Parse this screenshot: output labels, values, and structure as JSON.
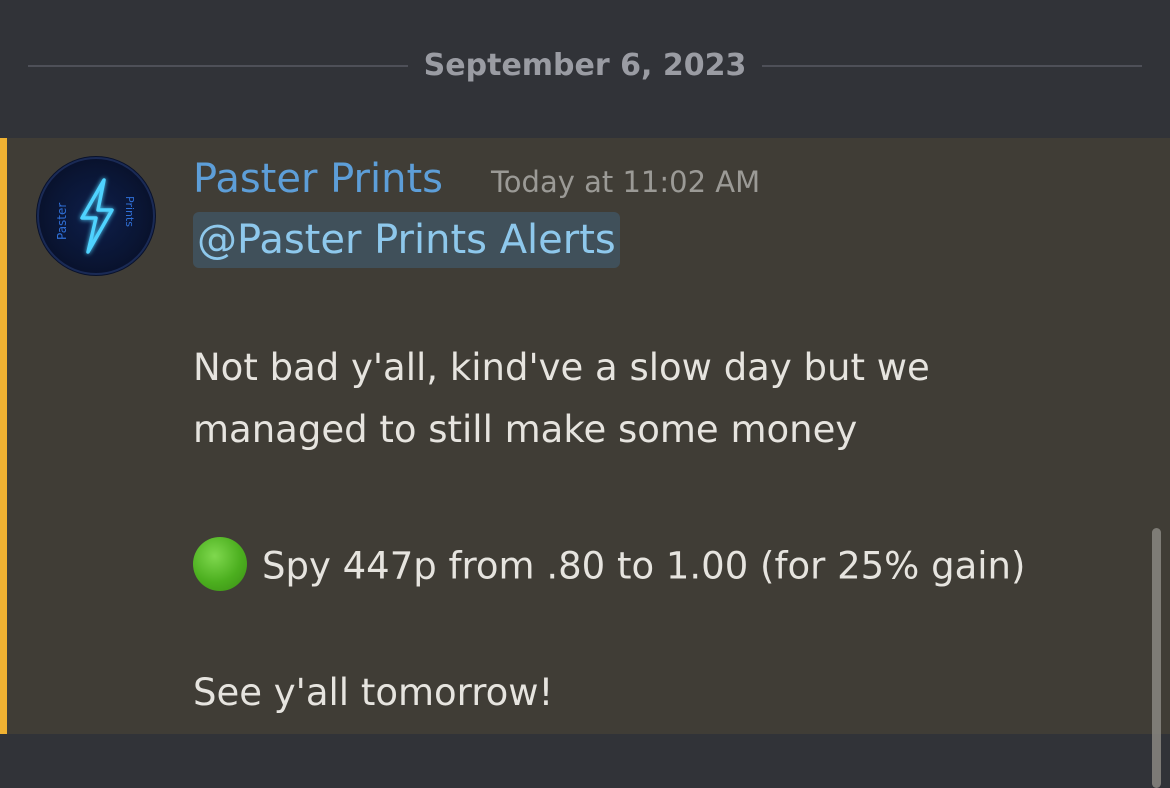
{
  "date_divider": {
    "text": "September 6, 2023"
  },
  "message": {
    "author": "Paster Prints",
    "timestamp": "Today at 11:02 AM",
    "mention": "@Paster Prints Alerts",
    "lines": [
      "Not bad y'all, kind've a slow day but we",
      "managed to still make some money",
      "Spy 447p from .80 to 1.00 (for 25% gain)",
      "See y'all tomorrow!"
    ],
    "avatar": {
      "text_left": "Paster",
      "text_right": "Prints",
      "icon": "lightning-bolt-icon"
    },
    "emoji_icon": "green-circle-icon"
  },
  "colors": {
    "background": "#313338",
    "message_highlight": "#403d36",
    "mention_bar": "#f0b232",
    "author": "#5d9ed8",
    "mention_text": "#8ec8ec"
  }
}
